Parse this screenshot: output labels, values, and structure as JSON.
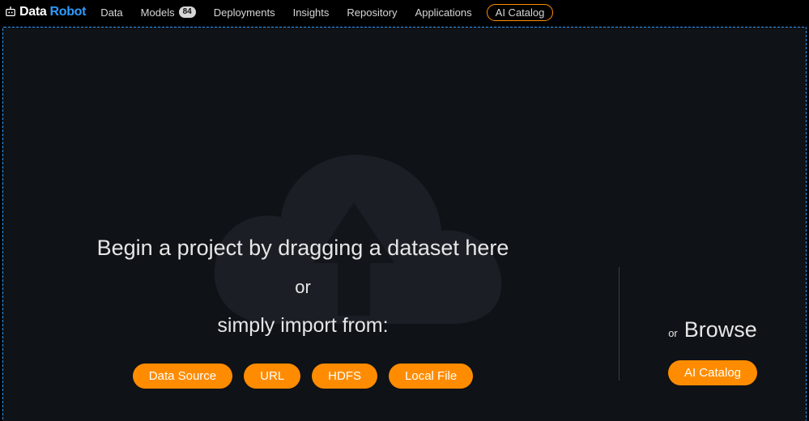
{
  "brand": {
    "word1": "Data",
    "word2": "Robot"
  },
  "nav": {
    "items": [
      {
        "label": "Data"
      },
      {
        "label": "Models",
        "badge": "84"
      },
      {
        "label": "Deployments"
      },
      {
        "label": "Insights"
      },
      {
        "label": "Repository"
      },
      {
        "label": "Applications"
      },
      {
        "label": "AI Catalog",
        "highlighted": true
      }
    ]
  },
  "dropzone": {
    "headline": "Begin a project by dragging a dataset here",
    "or": "or",
    "import_line": "simply import from:",
    "buttons": [
      {
        "label": "Data Source"
      },
      {
        "label": "URL"
      },
      {
        "label": "HDFS"
      },
      {
        "label": "Local File"
      }
    ],
    "browse_or": "or",
    "browse_label": "Browse",
    "browse_button": "AI Catalog"
  },
  "colors": {
    "accent_orange": "#ff8c00",
    "accent_blue": "#2e9bff",
    "bg_panel": "#0f1216"
  }
}
